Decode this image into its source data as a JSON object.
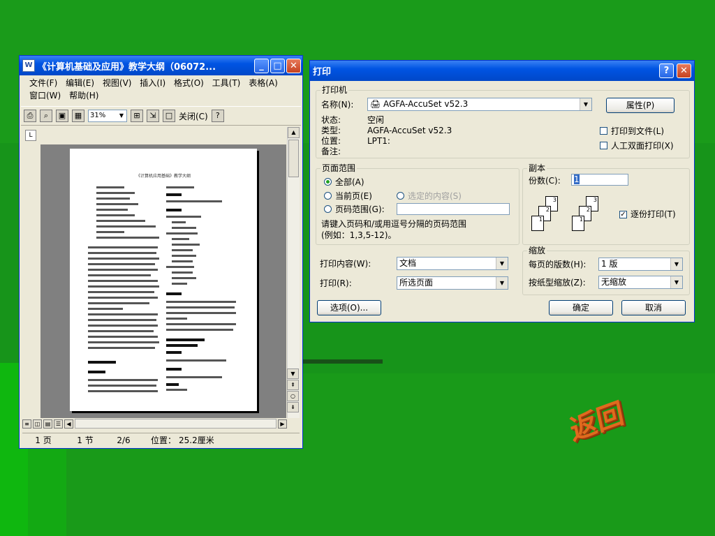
{
  "word_window": {
    "title": "《计算机基础及应用》教学大纲（06072...",
    "menus": [
      "文件(F)",
      "编辑(E)",
      "视图(V)",
      "插入(I)",
      "格式(O)",
      "工具(T)",
      "表格(A)",
      "窗口(W)",
      "帮助(H)"
    ],
    "zoom": "31%",
    "close_label": "关闭(C)",
    "ruler_corner": "L",
    "page_heading": "《计算机应用基础》教学大纲",
    "status": {
      "page": "1 页",
      "section": "1 节",
      "count": "2/6",
      "position_label": "位置：",
      "position_value": "25.2厘米"
    }
  },
  "print_dialog": {
    "title": "打印",
    "printer_group": "打印机",
    "name_label": "名称(N):",
    "printer_name": "AGFA-AccuSet v52.3",
    "properties_button": "属性(P)",
    "status_label": "状态:",
    "status_value": "空闲",
    "type_label": "类型:",
    "type_value": "AGFA-AccuSet v52.3",
    "where_label": "位置:",
    "where_value": "LPT1:",
    "comment_label": "备注:",
    "print_to_file": "打印到文件(L)",
    "manual_duplex": "人工双面打印(X)",
    "page_range_group": "页面范围",
    "all": "全部(A)",
    "current_page": "当前页(E)",
    "selection": "选定的内容(S)",
    "pages": "页码范围(G):",
    "hint_line1": "请键入页码和/或用逗号分隔的页码范围",
    "hint_line2": "(例如：1,3,5-12)。",
    "copies_group": "副本",
    "copies_label": "份数(C):",
    "copies_value": "1",
    "collate": "逐份打印(T)",
    "print_what_label": "打印内容(W):",
    "print_what_value": "文档",
    "print_label": "打印(R):",
    "print_value": "所选页面",
    "zoom_group": "缩放",
    "pages_per_sheet_label": "每页的版数(H):",
    "pages_per_sheet_value": "1 版",
    "scale_label": "按纸型缩放(Z):",
    "scale_value": "无缩放",
    "options_button": "选项(O)...",
    "ok_button": "确定",
    "cancel_button": "取消"
  },
  "return_button": "返回"
}
